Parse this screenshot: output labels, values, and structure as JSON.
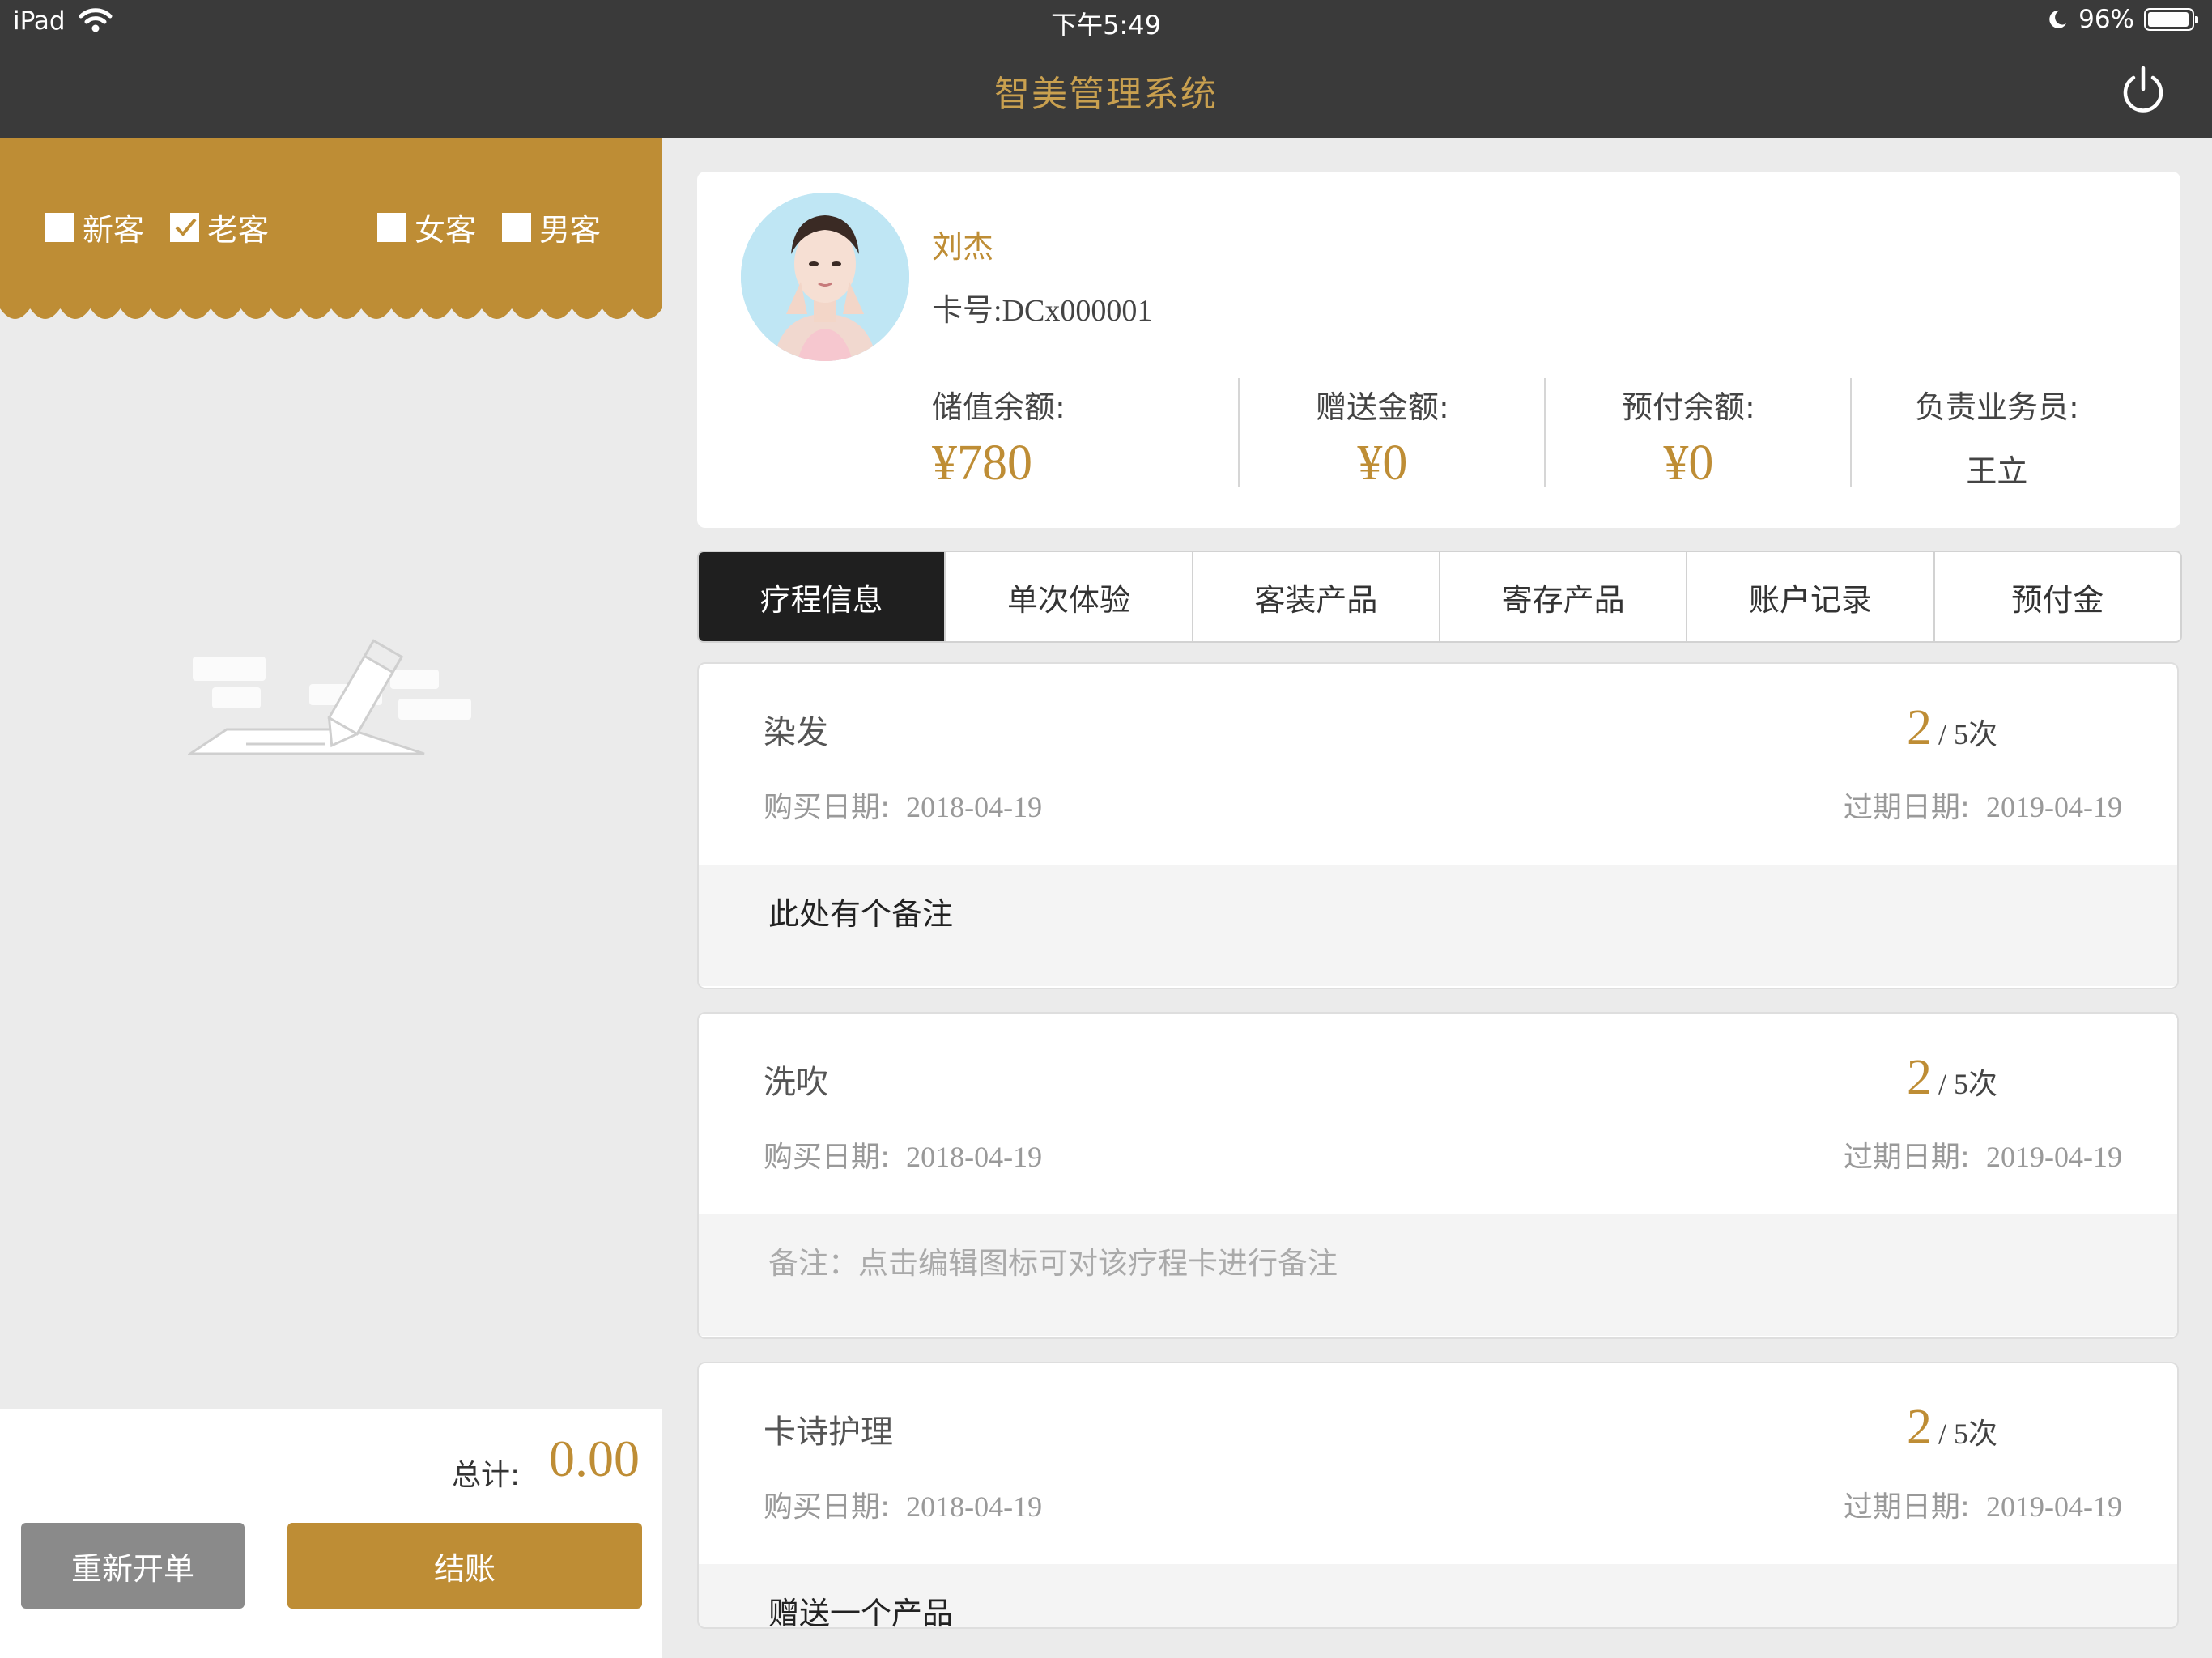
{
  "status_bar": {
    "carrier": "iPad",
    "time": "下午5:49",
    "battery": "96%"
  },
  "header": {
    "title": "智美管理系统",
    "power_icon": "power-icon"
  },
  "filters": [
    {
      "label": "新客",
      "checked": false
    },
    {
      "label": "老客",
      "checked": true
    },
    {
      "label": "女客",
      "checked": false
    },
    {
      "label": "男客",
      "checked": false
    }
  ],
  "cart": {
    "empty_icon": "empty-cart-illustration",
    "total_label": "总计:",
    "total_value": "0.00",
    "reset_label": "重新开单",
    "checkout_label": "结账"
  },
  "customer": {
    "name": "刘杰",
    "card_no": "卡号:DCx000001",
    "stats": [
      {
        "label": "储值余额:",
        "value": "¥780"
      },
      {
        "label": "赠送金额:",
        "value": "¥0"
      },
      {
        "label": "预付余额:",
        "value": "¥0"
      },
      {
        "label": "负责业务员:",
        "value": "王立"
      }
    ]
  },
  "tabs": [
    "疗程信息",
    "单次体验",
    "客装产品",
    "寄存产品",
    "账户记录",
    "预付金"
  ],
  "active_tab": 0,
  "courses": [
    {
      "name": "染发",
      "used": "2",
      "total": "/ 5次",
      "buy_label": "购买日期:",
      "buy_date": "2018-04-19",
      "exp_label": "过期日期:",
      "exp_date": "2019-04-19",
      "note": "此处有个备注"
    },
    {
      "name": "洗吹",
      "used": "2",
      "total": "/ 5次",
      "buy_label": "购买日期:",
      "buy_date": "2018-04-19",
      "exp_label": "过期日期:",
      "exp_date": "2019-04-19",
      "note": "备注：点击编辑图标可对该疗程卡进行备注"
    },
    {
      "name": "卡诗护理",
      "used": "2",
      "total": "/ 5次",
      "buy_label": "购买日期:",
      "buy_date": "2018-04-19",
      "exp_label": "过期日期:",
      "exp_date": "2019-04-19",
      "note": "赠送一个产品"
    }
  ],
  "colors": {
    "accent": "#be8d35",
    "topbar": "#3a3a3a",
    "tab_active": "#1f1f1f"
  }
}
